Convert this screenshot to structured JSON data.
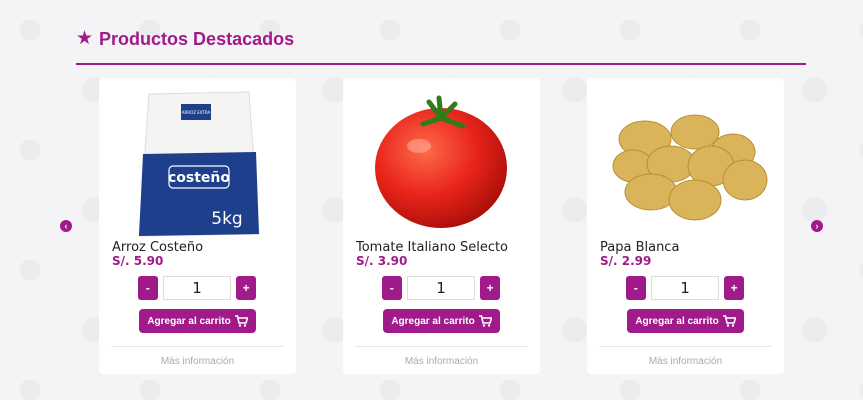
{
  "section": {
    "title": "Productos Destacados",
    "accent_color": "#a01a8a",
    "icons": {
      "title": "star-icon",
      "prev": "chevron-left-icon",
      "next": "chevron-right-icon",
      "cart": "cart-icon"
    }
  },
  "products": [
    {
      "name": "Arroz Costeño",
      "price": "S/. 5.90",
      "quantity": "1",
      "add_label": "Agregar al carrito",
      "more_label": "Más información",
      "minus": "-",
      "plus": "+",
      "bag": {
        "top": "ARROZ EXTRA",
        "brand": "costeño",
        "weight": "5kg"
      }
    },
    {
      "name": "Tomate Italiano Selecto",
      "price": "S/. 3.90",
      "quantity": "1",
      "add_label": "Agregar al carrito",
      "more_label": "Más información",
      "minus": "-",
      "plus": "+"
    },
    {
      "name": "Papa Blanca",
      "price": "S/. 2.99",
      "quantity": "1",
      "add_label": "Agregar al carrito",
      "more_label": "Más información",
      "minus": "-",
      "plus": "+"
    }
  ]
}
